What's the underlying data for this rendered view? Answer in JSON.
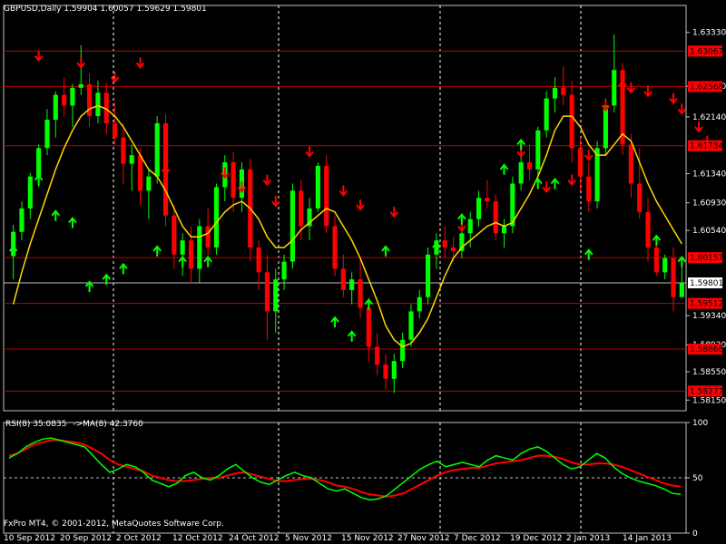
{
  "window": {
    "header": "GBPUSD,Daily  1.59904 1.60057 1.59629 1.59801",
    "copyright": "FxPro MT4, © 2001-2012, MetaQuotes Software Corp."
  },
  "colors": {
    "background": "#000000",
    "bull": "#00FF00",
    "bear": "#FF0000",
    "ma": "#FFD700",
    "rsi": "#00FF00",
    "rsi_ma": "#FF0000",
    "level_line": "#C00000",
    "grid": "#FFFFFF"
  },
  "chart_data": {
    "type": "candlestick",
    "symbol": "GBPUSD",
    "timeframe": "Daily",
    "last_bar": {
      "open": 1.59904,
      "high": 1.60057,
      "low": 1.59629,
      "close": 1.59801
    },
    "price_axis": {
      "ylim": [
        1.58,
        1.6371
      ],
      "ticks": [
        "1.63330",
        "1.62570",
        "1.62140",
        "1.61340",
        "1.60930",
        "1.60540",
        "1.59801",
        "1.59340",
        "1.58930",
        "1.58550",
        "1.58150"
      ],
      "levels": [
        "1.63067",
        "1.62568",
        "1.61734",
        "1.60157",
        "1.59512",
        "1.58868",
        "1.58277"
      ],
      "current": "1.59801"
    },
    "time_axis": [
      "10 Sep 2012",
      "20 Sep 2012",
      "2 Oct 2012",
      "12 Oct 2012",
      "24 Oct 2012",
      "5 Nov 2012",
      "15 Nov 2012",
      "27 Nov 2012",
      "7 Dec 2012",
      "19 Dec 2012",
      "2 Jan 2013",
      "14 Jan 2013"
    ],
    "ohlc": [
      [
        1.6018,
        1.6062,
        1.5985,
        1.6052
      ],
      [
        1.6052,
        1.6095,
        1.604,
        1.6085
      ],
      [
        1.6085,
        1.6135,
        1.607,
        1.613
      ],
      [
        1.613,
        1.6175,
        1.6115,
        1.617
      ],
      [
        1.617,
        1.6225,
        1.616,
        1.621
      ],
      [
        1.621,
        1.625,
        1.6185,
        1.6245
      ],
      [
        1.6245,
        1.627,
        1.6215,
        1.623
      ],
      [
        1.623,
        1.626,
        1.62,
        1.6255
      ],
      [
        1.6255,
        1.6315,
        1.6245,
        1.626
      ],
      [
        1.626,
        1.6275,
        1.62,
        1.6215
      ],
      [
        1.6215,
        1.6265,
        1.6205,
        1.6248
      ],
      [
        1.6248,
        1.6262,
        1.619,
        1.6205
      ],
      [
        1.6205,
        1.6235,
        1.6175,
        1.6185
      ],
      [
        1.6185,
        1.6205,
        1.612,
        1.6148
      ],
      [
        1.6148,
        1.6175,
        1.611,
        1.616
      ],
      [
        1.616,
        1.617,
        1.609,
        1.611
      ],
      [
        1.611,
        1.614,
        1.607,
        1.613
      ],
      [
        1.613,
        1.6215,
        1.612,
        1.6205
      ],
      [
        1.6205,
        1.6218,
        1.606,
        1.6075
      ],
      [
        1.6075,
        1.609,
        1.6,
        1.602
      ],
      [
        1.602,
        1.605,
        1.599,
        1.604
      ],
      [
        1.604,
        1.606,
        1.598,
        1.6
      ],
      [
        1.6,
        1.607,
        1.598,
        1.606
      ],
      [
        1.606,
        1.6085,
        1.6015,
        1.603
      ],
      [
        1.603,
        1.612,
        1.602,
        1.6115
      ],
      [
        1.6115,
        1.616,
        1.6095,
        1.615
      ],
      [
        1.615,
        1.6165,
        1.608,
        1.61
      ],
      [
        1.61,
        1.615,
        1.608,
        1.614
      ],
      [
        1.614,
        1.6155,
        1.601,
        1.603
      ],
      [
        1.603,
        1.604,
        1.597,
        1.5995
      ],
      [
        1.5995,
        1.602,
        1.59,
        1.594
      ],
      [
        1.594,
        1.6,
        1.591,
        1.5985
      ],
      [
        1.5985,
        1.602,
        1.597,
        1.601
      ],
      [
        1.601,
        1.612,
        1.6,
        1.611
      ],
      [
        1.611,
        1.6125,
        1.604,
        1.606
      ],
      [
        1.606,
        1.61,
        1.604,
        1.6085
      ],
      [
        1.6085,
        1.615,
        1.608,
        1.6145
      ],
      [
        1.6145,
        1.616,
        1.605,
        1.606
      ],
      [
        1.606,
        1.6075,
        1.599,
        1.6
      ],
      [
        1.6,
        1.602,
        1.596,
        1.597
      ],
      [
        1.597,
        1.5995,
        1.595,
        1.5985
      ],
      [
        1.5985,
        1.6015,
        1.593,
        1.5945
      ],
      [
        1.5945,
        1.596,
        1.587,
        1.589
      ],
      [
        1.589,
        1.591,
        1.585,
        1.5865
      ],
      [
        1.5865,
        1.588,
        1.583,
        1.5845
      ],
      [
        1.5845,
        1.588,
        1.5825,
        1.587
      ],
      [
        1.587,
        1.591,
        1.586,
        1.59
      ],
      [
        1.59,
        1.595,
        1.589,
        1.594
      ],
      [
        1.594,
        1.597,
        1.593,
        1.596
      ],
      [
        1.596,
        1.603,
        1.595,
        1.602
      ],
      [
        1.602,
        1.605,
        1.6,
        1.604
      ],
      [
        1.604,
        1.606,
        1.6015,
        1.603
      ],
      [
        1.603,
        1.6045,
        1.601,
        1.6025
      ],
      [
        1.6025,
        1.606,
        1.6015,
        1.605
      ],
      [
        1.605,
        1.608,
        1.603,
        1.607
      ],
      [
        1.607,
        1.611,
        1.606,
        1.61
      ],
      [
        1.61,
        1.6125,
        1.6085,
        1.6095
      ],
      [
        1.6095,
        1.6105,
        1.604,
        1.605
      ],
      [
        1.605,
        1.607,
        1.603,
        1.606
      ],
      [
        1.606,
        1.613,
        1.605,
        1.612
      ],
      [
        1.612,
        1.616,
        1.611,
        1.615
      ],
      [
        1.615,
        1.6175,
        1.6125,
        1.614
      ],
      [
        1.614,
        1.62,
        1.613,
        1.6195
      ],
      [
        1.6195,
        1.625,
        1.6185,
        1.624
      ],
      [
        1.624,
        1.627,
        1.622,
        1.6255
      ],
      [
        1.6255,
        1.6285,
        1.623,
        1.6245
      ],
      [
        1.6245,
        1.6265,
        1.615,
        1.617
      ],
      [
        1.617,
        1.6185,
        1.611,
        1.613
      ],
      [
        1.613,
        1.615,
        1.608,
        1.6095
      ],
      [
        1.6095,
        1.618,
        1.6085,
        1.617
      ],
      [
        1.617,
        1.624,
        1.616,
        1.623
      ],
      [
        1.623,
        1.633,
        1.622,
        1.628
      ],
      [
        1.628,
        1.629,
        1.616,
        1.6175
      ],
      [
        1.6175,
        1.619,
        1.61,
        1.612
      ],
      [
        1.612,
        1.617,
        1.607,
        1.608
      ],
      [
        1.608,
        1.61,
        1.601,
        1.603
      ],
      [
        1.603,
        1.604,
        1.599,
        1.5995
      ],
      [
        1.5995,
        1.602,
        1.5985,
        1.6015
      ],
      [
        1.6015,
        1.603,
        1.594,
        1.596
      ],
      [
        1.596,
        1.6006,
        1.5963,
        1.598
      ]
    ],
    "ma": [
      1.595,
      1.5995,
      1.6035,
      1.607,
      1.6105,
      1.614,
      1.617,
      1.6195,
      1.6215,
      1.6225,
      1.623,
      1.6225,
      1.6215,
      1.62,
      1.618,
      1.616,
      1.614,
      1.613,
      1.611,
      1.6085,
      1.606,
      1.6045,
      1.6045,
      1.605,
      1.6065,
      1.608,
      1.609,
      1.6095,
      1.6085,
      1.607,
      1.6045,
      1.603,
      1.603,
      1.604,
      1.6055,
      1.6065,
      1.6075,
      1.6085,
      1.608,
      1.606,
      1.604,
      1.6015,
      1.5985,
      1.5955,
      1.592,
      1.59,
      1.589,
      1.5895,
      1.591,
      1.593,
      1.596,
      1.599,
      1.6015,
      1.603,
      1.604,
      1.605,
      1.606,
      1.6065,
      1.606,
      1.6065,
      1.6085,
      1.6105,
      1.613,
      1.616,
      1.6195,
      1.6215,
      1.6215,
      1.62,
      1.6175,
      1.616,
      1.616,
      1.6175,
      1.619,
      1.618,
      1.615,
      1.612,
      1.6095,
      1.6075,
      1.6055,
      1.6035
    ],
    "signals": {
      "down": [
        [
          3,
          1.63
        ],
        [
          8,
          1.629
        ],
        [
          12,
          1.627
        ],
        [
          15,
          1.629
        ],
        [
          18,
          1.614
        ],
        [
          25,
          1.6135
        ],
        [
          27,
          1.6115
        ],
        [
          30,
          1.6125
        ],
        [
          31,
          1.6095
        ],
        [
          35,
          1.6165
        ],
        [
          39,
          1.611
        ],
        [
          41,
          1.609
        ],
        [
          45,
          1.608
        ],
        [
          53,
          1.606
        ],
        [
          60,
          1.6165
        ],
        [
          63,
          1.6115
        ],
        [
          66,
          1.6125
        ],
        [
          68,
          1.616
        ],
        [
          70,
          1.623
        ],
        [
          72,
          1.626
        ],
        [
          73,
          1.6255
        ],
        [
          75,
          1.625
        ],
        [
          78,
          1.624
        ],
        [
          79,
          1.6225
        ],
        [
          81,
          1.62
        ],
        [
          82,
          1.618
        ]
      ],
      "up": [
        [
          0,
          1.6025
        ],
        [
          3,
          1.6125
        ],
        [
          5,
          1.6075
        ],
        [
          7,
          1.6065
        ],
        [
          9,
          1.5975
        ],
        [
          11,
          1.5985
        ],
        [
          13,
          1.6
        ],
        [
          17,
          1.6025
        ],
        [
          20,
          1.601
        ],
        [
          23,
          1.601
        ],
        [
          38,
          1.5925
        ],
        [
          40,
          1.5905
        ],
        [
          42,
          1.595
        ],
        [
          44,
          1.6025
        ],
        [
          50,
          1.603
        ],
        [
          53,
          1.607
        ],
        [
          58,
          1.614
        ],
        [
          60,
          1.6175
        ],
        [
          62,
          1.612
        ],
        [
          64,
          1.612
        ],
        [
          68,
          1.602
        ],
        [
          76,
          1.604
        ],
        [
          79,
          1.601
        ]
      ]
    },
    "rsi": {
      "label": "RSI(8) 35.0835",
      "ma_label": "->MA(8) 42.3760",
      "ylim": [
        0,
        100
      ],
      "ticks": [
        "100",
        "50",
        "0"
      ],
      "rsi": [
        68,
        72,
        78,
        82,
        85,
        86,
        84,
        82,
        80,
        78,
        70,
        62,
        55,
        58,
        62,
        60,
        55,
        48,
        45,
        42,
        45,
        52,
        55,
        50,
        48,
        52,
        58,
        62,
        56,
        50,
        46,
        44,
        48,
        52,
        55,
        52,
        50,
        45,
        40,
        38,
        40,
        36,
        32,
        30,
        31,
        34,
        40,
        46,
        52,
        58,
        62,
        65,
        60,
        62,
        64,
        62,
        60,
        66,
        70,
        68,
        66,
        72,
        76,
        78,
        74,
        68,
        62,
        58,
        60,
        66,
        72,
        68,
        60,
        54,
        50,
        47,
        45,
        43,
        40,
        36,
        35
      ],
      "ma": [
        70,
        72,
        76,
        80,
        82,
        84,
        84,
        83,
        82,
        80,
        76,
        72,
        66,
        62,
        60,
        58,
        56,
        52,
        50,
        48,
        47,
        47,
        48,
        49,
        50,
        50,
        52,
        54,
        55,
        53,
        51,
        49,
        47,
        47,
        48,
        49,
        49,
        48,
        46,
        43,
        42,
        40,
        37,
        35,
        34,
        33,
        34,
        36,
        40,
        44,
        48,
        52,
        55,
        57,
        58,
        59,
        59,
        61,
        63,
        64,
        65,
        66,
        68,
        70,
        70,
        69,
        67,
        64,
        62,
        62,
        63,
        63,
        62,
        60,
        57,
        54,
        51,
        48,
        45,
        43,
        42
      ]
    }
  }
}
